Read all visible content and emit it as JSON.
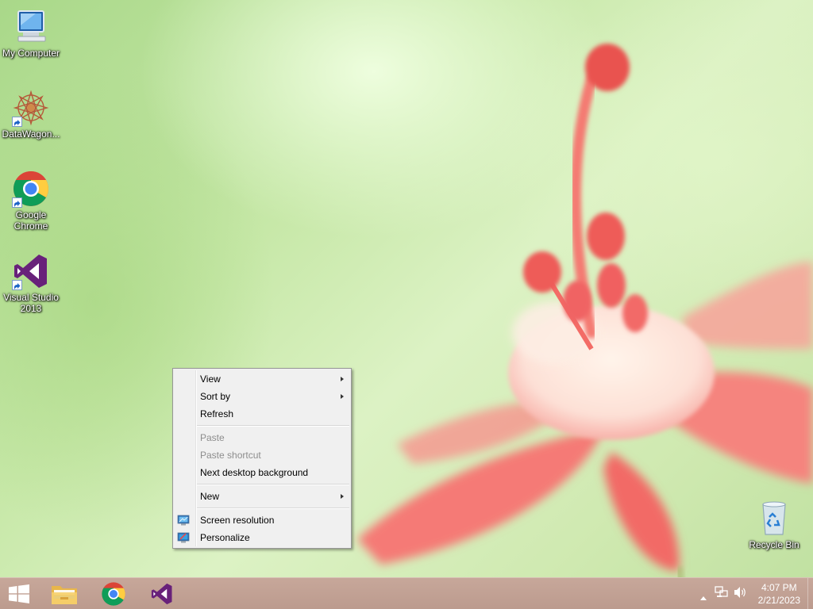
{
  "desktop_icons": [
    {
      "id": "my-computer",
      "label": "My Computer",
      "shortcut": false
    },
    {
      "id": "datawagon",
      "label": "DataWagon...",
      "shortcut": true
    },
    {
      "id": "google-chrome",
      "label": "Google Chrome",
      "shortcut": true
    },
    {
      "id": "visual-studio",
      "label": "Visual Studio 2013",
      "shortcut": true
    },
    {
      "id": "recycle-bin",
      "label": "Recycle Bin",
      "shortcut": false
    }
  ],
  "context_menu": {
    "items": [
      {
        "label": "View",
        "submenu": true,
        "disabled": false
      },
      {
        "label": "Sort by",
        "submenu": true,
        "disabled": false
      },
      {
        "label": "Refresh",
        "submenu": false,
        "disabled": false
      },
      {
        "label": "Paste",
        "submenu": false,
        "disabled": true
      },
      {
        "label": "Paste shortcut",
        "submenu": false,
        "disabled": true
      },
      {
        "label": "Next desktop background",
        "submenu": false,
        "disabled": false
      },
      {
        "label": "New",
        "submenu": true,
        "disabled": false
      },
      {
        "label": "Screen resolution",
        "submenu": false,
        "disabled": false,
        "icon": "monitor-icon"
      },
      {
        "label": "Personalize",
        "submenu": false,
        "disabled": false,
        "icon": "personalize-icon"
      }
    ]
  },
  "taskbar": {
    "pinned": [
      {
        "name": "start-button",
        "icon": "windows-logo-icon"
      },
      {
        "name": "file-explorer",
        "icon": "folder-icon"
      },
      {
        "name": "google-chrome",
        "icon": "chrome-icon"
      },
      {
        "name": "visual-studio",
        "icon": "visual-studio-icon"
      }
    ],
    "tray": {
      "icons": [
        "show-hidden-icons-icon",
        "network-icon",
        "volume-icon"
      ],
      "time": "4:07 PM",
      "date": "2/21/2023"
    }
  },
  "colors": {
    "taskbar": "#c1a194",
    "menu_bg": "#f0f0f0",
    "vs_purple": "#68217a",
    "flower": "#f2787a"
  }
}
